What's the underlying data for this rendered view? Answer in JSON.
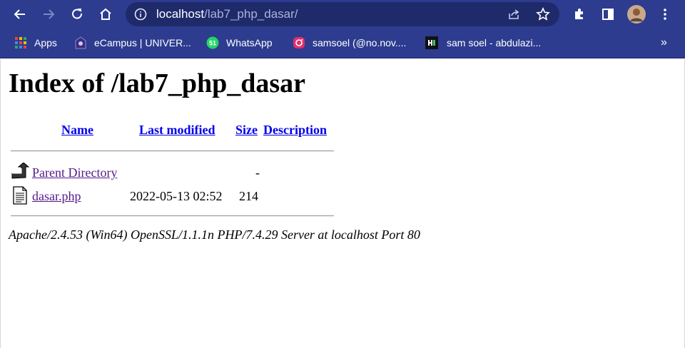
{
  "browser": {
    "url_host": "localhost",
    "url_path": "/lab7_php_dasar/",
    "icons": {
      "back": "back-arrow-icon",
      "forward": "forward-arrow-icon",
      "reload": "reload-icon",
      "home": "home-icon",
      "info": "info-icon",
      "share": "share-icon",
      "star": "bookmark-star-icon",
      "extensions": "puzzle-icon",
      "sidepanel": "side-panel-icon",
      "menu": "kebab-menu-icon"
    },
    "accent": "#2d3c8f",
    "omnibox_bg": "#1f2a6b"
  },
  "bookmarks": {
    "items": [
      {
        "label": "Apps",
        "icon": "apps-grid-icon"
      },
      {
        "label": "eCampus | UNIVER...",
        "icon": "ecampus-icon"
      },
      {
        "label": "WhatsApp",
        "icon": "whatsapp-icon",
        "badge": "51"
      },
      {
        "label": "samsoel (@no.nov....",
        "icon": "instagram-icon"
      },
      {
        "label": "sam soel - abdulazi...",
        "icon": "site-icon"
      }
    ],
    "overflow": "»"
  },
  "page": {
    "title": "Index of /lab7_php_dasar",
    "columns": {
      "name": "Name",
      "last_modified": "Last modified",
      "size": "Size",
      "description": "Description"
    },
    "rows": [
      {
        "name": "Parent Directory",
        "last_modified": "",
        "size": "-",
        "description": "",
        "icon": "parent-directory-icon"
      },
      {
        "name": "dasar.php",
        "last_modified": "2022-05-13 02:52",
        "size": "214",
        "description": "",
        "icon": "text-file-icon"
      }
    ],
    "footer": "Apache/2.4.53 (Win64) OpenSSL/1.1.1n PHP/7.4.29 Server at localhost Port 80"
  }
}
